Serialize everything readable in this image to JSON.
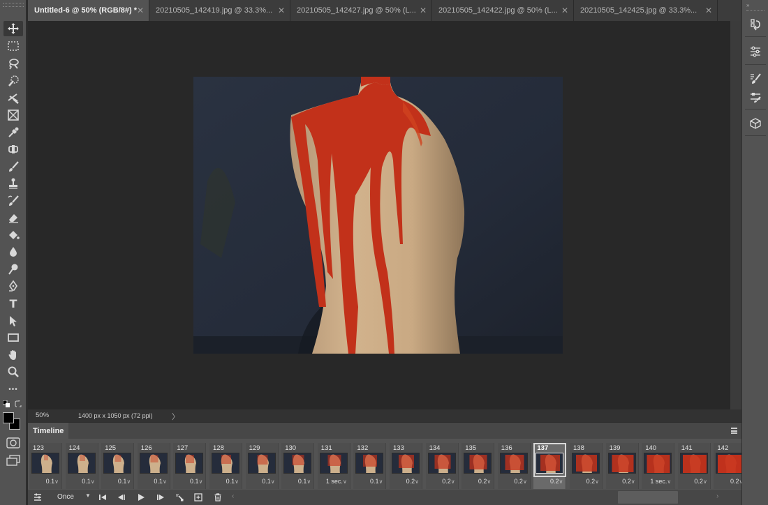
{
  "tabs": [
    {
      "label": "Untitled-6 @ 50% (RGB/8#) *",
      "active": true
    },
    {
      "label": "20210505_142419.jpg @ 33.3%...",
      "active": false
    },
    {
      "label": "20210505_142427.jpg @ 50% (L...",
      "active": false
    },
    {
      "label": "20210505_142422.jpg @ 50% (L...",
      "active": false
    },
    {
      "label": "20210505_142425.jpg @ 33.3%...",
      "active": false
    }
  ],
  "tools": [
    {
      "name": "move-tool",
      "icon": "move-icon"
    },
    {
      "name": "marquee-tool",
      "icon": "rect-marquee-icon"
    },
    {
      "name": "lasso-tool",
      "icon": "lasso-icon"
    },
    {
      "name": "quick-select-tool",
      "icon": "quick-select-icon"
    },
    {
      "name": "crop-tool",
      "icon": "crop-icon"
    },
    {
      "name": "frame-tool",
      "icon": "frame-icon"
    },
    {
      "name": "eyedropper-tool",
      "icon": "eyedropper-icon"
    },
    {
      "name": "healing-tool",
      "icon": "healing-icon"
    },
    {
      "name": "brush-tool",
      "icon": "brush-icon"
    },
    {
      "name": "stamp-tool",
      "icon": "stamp-icon"
    },
    {
      "name": "history-brush-tool",
      "icon": "history-brush-icon"
    },
    {
      "name": "eraser-tool",
      "icon": "eraser-icon"
    },
    {
      "name": "paint-bucket-tool",
      "icon": "paint-bucket-icon"
    },
    {
      "name": "blur-tool",
      "icon": "blur-icon"
    },
    {
      "name": "dodge-tool",
      "icon": "dodge-icon"
    },
    {
      "name": "pen-tool",
      "icon": "pen-icon"
    },
    {
      "name": "type-tool",
      "icon": "type-icon"
    },
    {
      "name": "path-select-tool",
      "icon": "path-select-icon"
    },
    {
      "name": "rectangle-tool",
      "icon": "rectangle-icon"
    },
    {
      "name": "hand-tool",
      "icon": "hand-icon"
    },
    {
      "name": "zoom-tool",
      "icon": "zoom-icon"
    },
    {
      "name": "more-tools",
      "icon": "ellipsis-icon"
    }
  ],
  "type_tool_glyph": "T",
  "more_tools_glyph": "•••",
  "status": {
    "zoom": "50%",
    "doc_info": "1400 px x 1050 px (72 ppi)",
    "arrow": "〉"
  },
  "timeline": {
    "title": "Timeline",
    "loop": "Once",
    "frames": [
      {
        "num": "123",
        "delay": "0.1",
        "selected": false
      },
      {
        "num": "124",
        "delay": "0.1",
        "selected": false
      },
      {
        "num": "125",
        "delay": "0.1",
        "selected": false
      },
      {
        "num": "126",
        "delay": "0.1",
        "selected": false
      },
      {
        "num": "127",
        "delay": "0.1",
        "selected": false
      },
      {
        "num": "128",
        "delay": "0.1",
        "selected": false
      },
      {
        "num": "129",
        "delay": "0.1",
        "selected": false
      },
      {
        "num": "130",
        "delay": "0.1",
        "selected": false
      },
      {
        "num": "131",
        "delay": "1 sec.",
        "selected": false
      },
      {
        "num": "132",
        "delay": "0.1",
        "selected": false
      },
      {
        "num": "133",
        "delay": "0.2",
        "selected": false
      },
      {
        "num": "134",
        "delay": "0.2",
        "selected": false
      },
      {
        "num": "135",
        "delay": "0.2",
        "selected": false
      },
      {
        "num": "136",
        "delay": "0.2",
        "selected": false
      },
      {
        "num": "137",
        "delay": "0.2",
        "selected": true
      },
      {
        "num": "138",
        "delay": "0.2",
        "selected": false
      },
      {
        "num": "139",
        "delay": "0.2",
        "selected": false
      },
      {
        "num": "140",
        "delay": "1 sec.",
        "selected": false
      },
      {
        "num": "141",
        "delay": "0.2",
        "selected": false
      },
      {
        "num": "142",
        "delay": "0.2",
        "selected": false
      }
    ]
  },
  "colors": {
    "paint_red": "#c8321a",
    "mannequin": "#cdb08c",
    "backdrop": "#252c3b"
  }
}
